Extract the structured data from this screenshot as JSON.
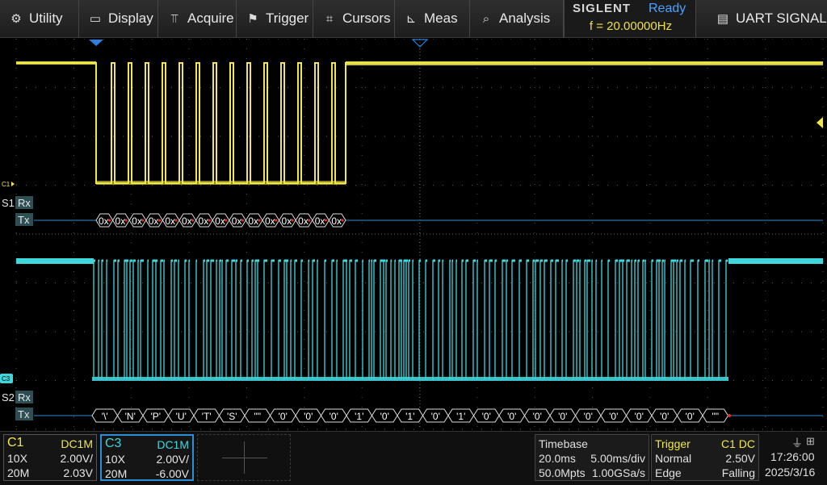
{
  "menu": {
    "utility": "Utility",
    "display": "Display",
    "acquire": "Acquire",
    "trigger": "Trigger",
    "cursors": "Cursors",
    "meas": "Meas",
    "analysis": "Analysis",
    "uart": "UART SIGNAL"
  },
  "brand": {
    "logo": "SIGLENT",
    "status": "Ready",
    "frequency": "f = 20.00000Hz"
  },
  "labels": {
    "c1_marker": "C1",
    "c3_marker": "C3",
    "s1": "S1",
    "s2": "S2",
    "rx": "Rx",
    "tx": "Tx"
  },
  "decode": {
    "s1_tx_symbols": [
      "0x",
      "0x",
      "0x",
      "0x",
      "0x",
      "0x",
      "0x",
      "0x",
      "0x",
      "0x",
      "0x",
      "0x",
      "0x",
      "0x",
      "0x",
      "0x"
    ],
    "s2_tx_symbols": [
      "'\\'",
      "'N'",
      "'P'",
      "'U'",
      "'T'",
      "'S'",
      "'\"'",
      "'0'",
      "'0'",
      "'0'",
      "'1'",
      "'0'",
      "'1'",
      "'0'",
      "'1'",
      "'0'",
      "'0'",
      "'0'",
      "'0'",
      "'0'",
      "'0'",
      "'0'",
      "'0'",
      "'0'",
      "'\"'"
    ]
  },
  "channels": {
    "c1": {
      "name": "C1",
      "coupling": "DC1M",
      "probe": "10X",
      "scale": "2.00V/",
      "bw": "20M",
      "offset": "2.03V",
      "color": "#f2e84a"
    },
    "c3": {
      "name": "C3",
      "coupling": "DC1M",
      "probe": "10X",
      "scale": "2.00V/",
      "bw": "20M",
      "offset": "-6.00V",
      "color": "#3fd6dc"
    }
  },
  "timebase": {
    "title": "Timebase",
    "delay": "20.0ms",
    "scale": "5.00ms/div",
    "memory": "50.0Mpts",
    "rate": "1.00GSa/s"
  },
  "trigger": {
    "title": "Trigger",
    "source": "C1 DC",
    "mode": "Normal",
    "level": "2.50V",
    "type": "Edge",
    "slope": "Falling"
  },
  "clock": {
    "time": "17:26:00",
    "date": "2025/3/16"
  },
  "colors": {
    "ch1": "#f2e84a",
    "ch3": "#3fd6dc",
    "decode_line": "#2a8fd6",
    "grid": "#5a5a5a",
    "accent": "#4aa3ff"
  }
}
